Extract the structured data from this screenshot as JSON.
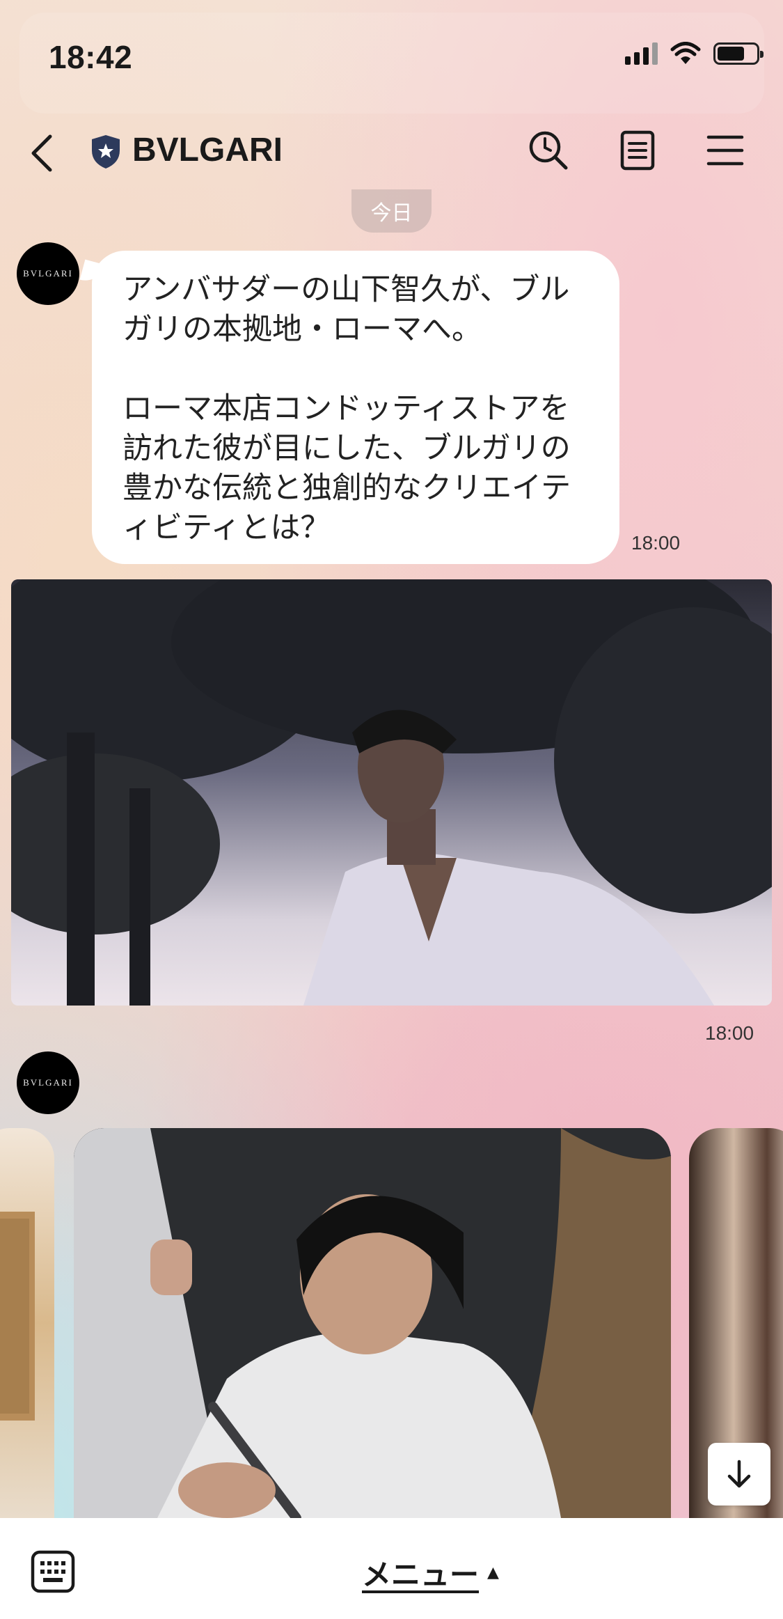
{
  "status_bar": {
    "time": "18:42"
  },
  "header": {
    "title": "BVLGARI"
  },
  "chat": {
    "date_label": "今日",
    "avatar_text": "BVLGARI",
    "message_text": "アンバサダーの山下智久が、ブル\nガリの本拠地・ローマへ。\n\nローマ本店コンドッティストアを\n訪れた彼が目にした、ブルガリの\n豊かな伝統と独創的なクリエイテ\nィビティとは？",
    "message_time": "18:00",
    "image_time": "18:00"
  },
  "bottom": {
    "menu_label": "メニュー",
    "menu_arrow": "▲"
  },
  "colors": {
    "accent": "#2d3a5c",
    "bubble": "#ffffff"
  },
  "icons": [
    "back-icon",
    "shield-icon",
    "search-icon",
    "notes-icon",
    "hamburger-icon",
    "keyboard-icon",
    "arrow-down-icon"
  ]
}
